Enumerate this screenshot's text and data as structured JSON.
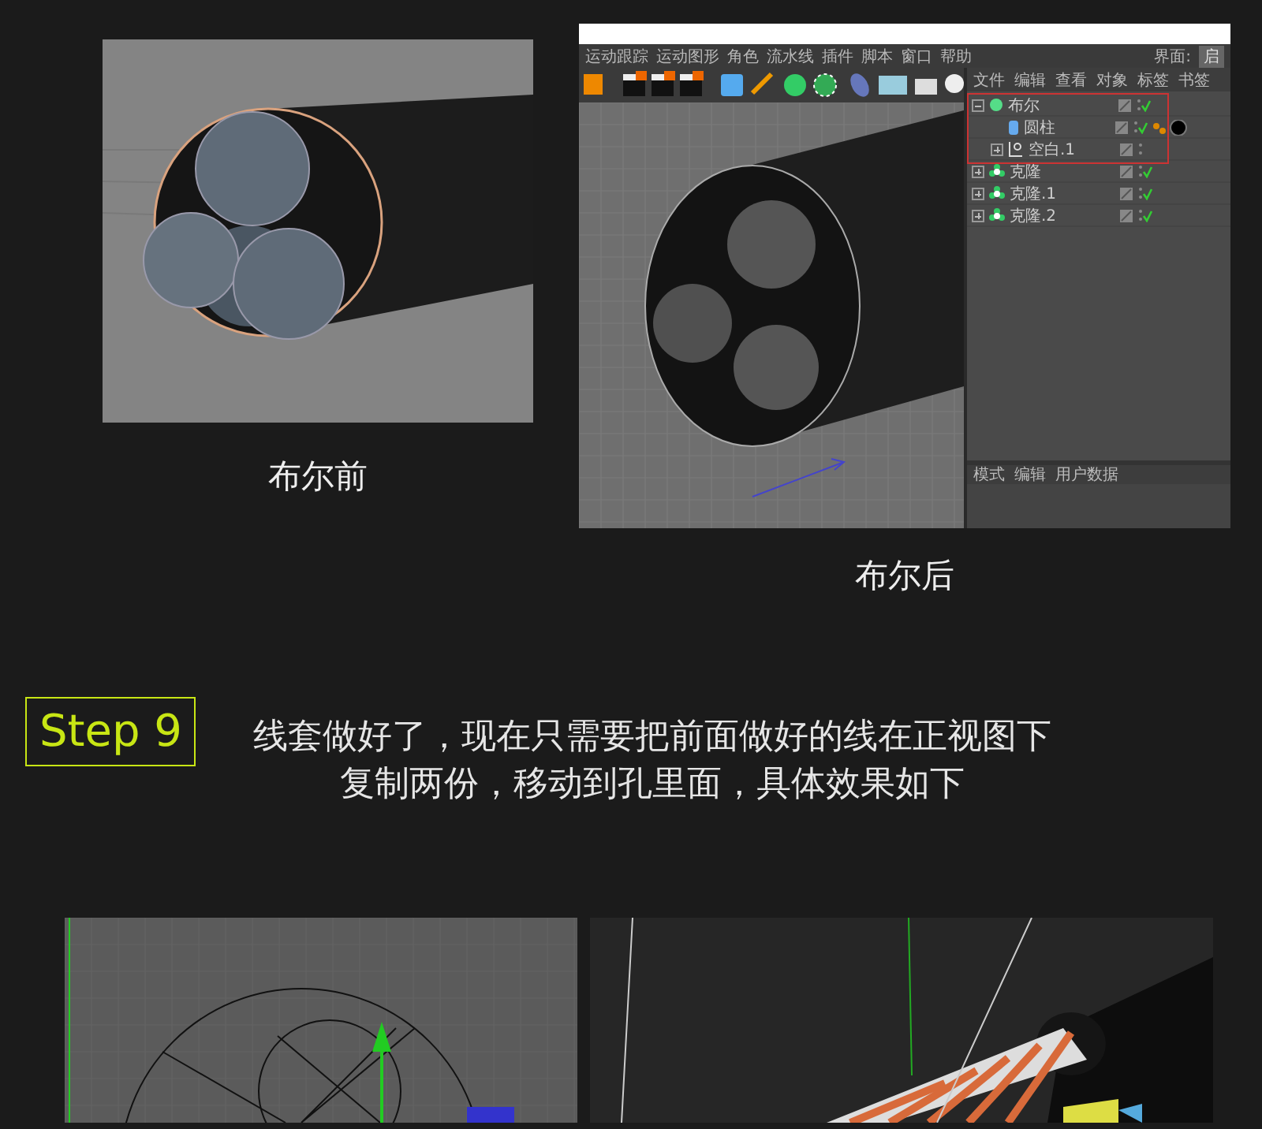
{
  "figures": [
    {
      "caption": "布尔前"
    },
    {
      "caption": "布尔后"
    }
  ],
  "app": {
    "menu": [
      "运动跟踪",
      "运动图形",
      "角色",
      "流水线",
      "插件",
      "脚本",
      "窗口",
      "帮助"
    ],
    "layout_label": "界面:",
    "layout_value": "启",
    "object_tabs": [
      "文件",
      "编辑",
      "查看",
      "对象",
      "标签",
      "书签"
    ],
    "objects": [
      {
        "name": "布尔",
        "kind": "boole",
        "expanded": true,
        "enabled": true,
        "children": [
          {
            "name": "圆柱",
            "kind": "cylinder",
            "enabled": true
          },
          {
            "name": "空白.1",
            "kind": "null",
            "expanded": false,
            "enabled": false
          }
        ]
      },
      {
        "name": "克隆",
        "kind": "cloner",
        "expanded": false,
        "enabled": true
      },
      {
        "name": "克隆.1",
        "kind": "cloner",
        "expanded": false,
        "enabled": true
      },
      {
        "name": "克隆.2",
        "kind": "cloner",
        "expanded": false,
        "enabled": true
      }
    ],
    "attribute_tabs": [
      "模式",
      "编辑",
      "用户数据"
    ]
  },
  "step": {
    "label": "Step 9",
    "lines": [
      "线套做好了，现在只需要把前面做好的线在正视图下",
      "复制两份，移动到孔里面，具体效果如下"
    ]
  }
}
